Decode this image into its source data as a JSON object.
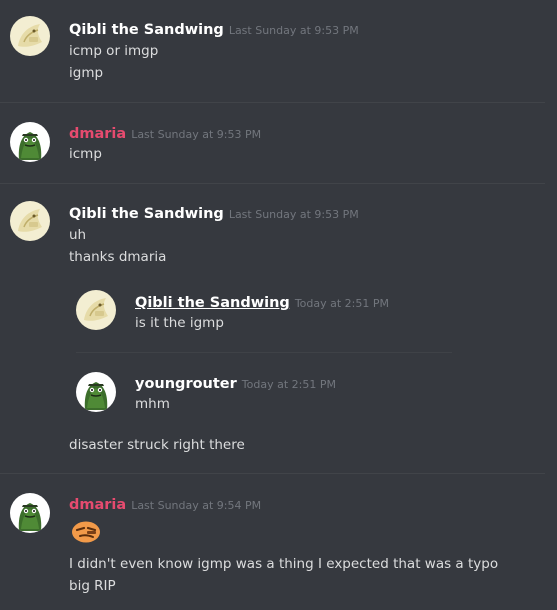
{
  "messages": [
    {
      "author": "Qibli the Sandwing",
      "timestamp": "Last Sunday at 9:53 PM",
      "lines": [
        "icmp or imgp",
        "igmp"
      ]
    },
    {
      "author": "dmaria",
      "timestamp": "Last Sunday at 9:53 PM",
      "lines": [
        "icmp"
      ]
    },
    {
      "author": "Qibli the Sandwing",
      "timestamp": "Last Sunday at 9:53 PM",
      "lines": [
        "uh",
        "thanks dmaria"
      ],
      "quoted": [
        {
          "author": "Qibli the Sandwing",
          "timestamp": "Today at 2:51 PM",
          "lines": [
            "is it the igmp"
          ]
        },
        {
          "author": "youngrouter",
          "timestamp": "Today at 2:51 PM",
          "lines": [
            "mhm"
          ]
        }
      ],
      "after_lines": [
        "disaster struck right there"
      ]
    },
    {
      "author": "dmaria",
      "timestamp": "Last Sunday at 9:54 PM",
      "emoji": "smirk-face-emoji",
      "lines": [
        "I didn't even know igmp was a thing I expected that was a typo",
        "big RIP"
      ]
    }
  ],
  "colors": {
    "background": "#36393f",
    "username_default": "#ffffff",
    "username_dmaria": "#e64b6f",
    "timestamp": "#72767d",
    "message_text": "#dcddde"
  },
  "icons": {
    "qibli_avatar": "sandwing-dragon-avatar",
    "dmaria_avatar": "green-monster-avatar",
    "youngrouter_avatar": "green-monster-avatar"
  }
}
